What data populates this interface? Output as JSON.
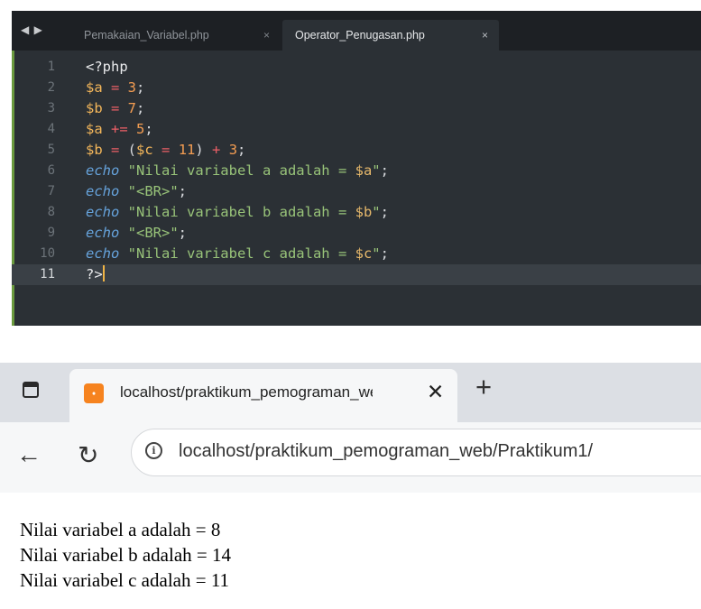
{
  "editor": {
    "nav_arrows": "◀ ▶",
    "tabs": [
      {
        "label": "Pemakaian_Variabel.php",
        "close": "×"
      },
      {
        "label": "Operator_Penugasan.php",
        "close": "×"
      }
    ],
    "line_numbers": [
      "1",
      "2",
      "3",
      "4",
      "5",
      "6",
      "7",
      "8",
      "9",
      "10",
      "11"
    ],
    "code": {
      "l1": {
        "tag": "<?php"
      },
      "l2": {
        "var": "$a",
        "op": " = ",
        "num": "3",
        "end": ";"
      },
      "l3": {
        "var": "$b",
        "op": " = ",
        "num": "7",
        "end": ";"
      },
      "l4": {
        "var": "$a",
        "op": " += ",
        "num": "5",
        "end": ";"
      },
      "l5": {
        "var1": "$b",
        "op1": " = ",
        "paren1": "(",
        "var2": "$c",
        "op2": " = ",
        "num1": "11",
        "paren2": ")",
        "op3": " + ",
        "num2": "3",
        "end": ";"
      },
      "l6": {
        "kw": "echo",
        "str": " \"Nilai variabel a adalah = ",
        "ivar": "$a",
        "str2": "\"",
        "end": ";"
      },
      "l7": {
        "kw": "echo",
        "str": " \"<BR>\"",
        "end": ";"
      },
      "l8": {
        "kw": "echo",
        "str": " \"Nilai variabel b adalah = ",
        "ivar": "$b",
        "str2": "\"",
        "end": ";"
      },
      "l9": {
        "kw": "echo",
        "str": " \"<BR>\"",
        "end": ";"
      },
      "l10": {
        "kw": "echo",
        "str": " \"Nilai variabel c adalah = ",
        "ivar": "$c",
        "str2": "\"",
        "end": ";"
      },
      "l11": {
        "tag": "?>"
      }
    }
  },
  "browser": {
    "tab_title": "localhost/praktikum_pemograman_web",
    "tab_close": "✕",
    "new_tab": "+",
    "favicon": "ꞏ",
    "url": "localhost/praktikum_pemograman_web/Praktikum1/",
    "output": [
      "Nilai variabel a adalah = 8",
      "Nilai variabel b adalah = 14",
      "Nilai variabel c adalah = 11"
    ]
  },
  "icons": {
    "back": "arrow-left-icon",
    "reload": "reload-icon",
    "info": "info-icon",
    "sidebar": "sidebar-icon",
    "favicon": "xampp-icon"
  },
  "colors": {
    "editor_bg": "#2b3035",
    "keyword": "#66a3dc",
    "string": "#98c379",
    "number": "#f49d52",
    "operator": "#ec5f67",
    "variable": "#f3b65a"
  }
}
